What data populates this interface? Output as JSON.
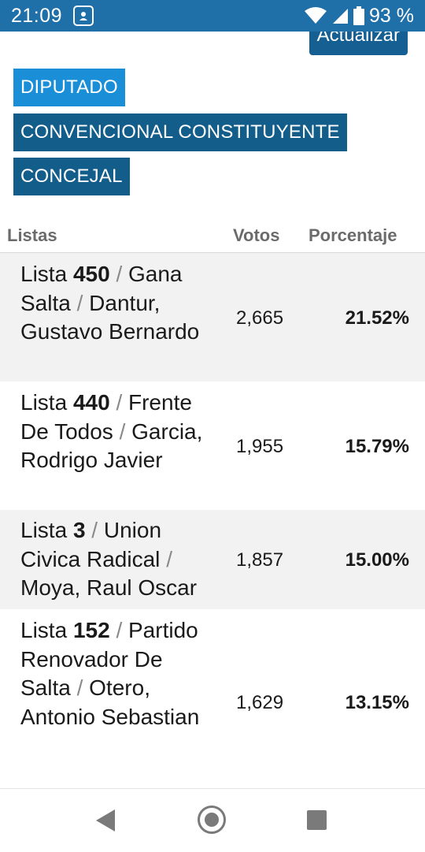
{
  "status_bar": {
    "time": "21:09",
    "battery_percent": "93 %",
    "icons": [
      "notification-icon",
      "wifi-icon",
      "signal-icon",
      "battery-icon"
    ]
  },
  "refresh_button": {
    "label": "Actualizar"
  },
  "tabs": [
    {
      "label": "DIPUTADO",
      "active": true
    },
    {
      "label": "CONVENCIONAL CONSTITUYENTE",
      "active": false
    },
    {
      "label": "CONCEJAL",
      "active": false
    }
  ],
  "table": {
    "headers": {
      "listas": "Listas",
      "votos": "Votos",
      "porcentaje": "Porcentaje"
    },
    "rows": [
      {
        "prefix": "Lista",
        "number": "450",
        "party": "Gana Salta",
        "candidate": "Dantur, Gustavo Bernardo",
        "votes": "2,665",
        "percent": "21.52%"
      },
      {
        "prefix": "Lista",
        "number": "440",
        "party": "Frente De Todos",
        "candidate": "Garcia, Rodrigo Javier",
        "votes": "1,955",
        "percent": "15.79%"
      },
      {
        "prefix": "Lista",
        "number": "3",
        "party": "Union Civica Radical",
        "candidate": "Moya, Raul Oscar",
        "votes": "1,857",
        "percent": "15.00%"
      },
      {
        "prefix": "Lista",
        "number": "152",
        "party": "Partido Renovador De Salta",
        "candidate": "Otero, Antonio Sebastian",
        "votes": "1,629",
        "percent": "13.15%"
      }
    ]
  },
  "colors": {
    "status_bar": "#1f6fa8",
    "tab_active": "#1a8ed6",
    "tab_inactive": "#135d8a",
    "row_shade": "#f2f2f2"
  }
}
